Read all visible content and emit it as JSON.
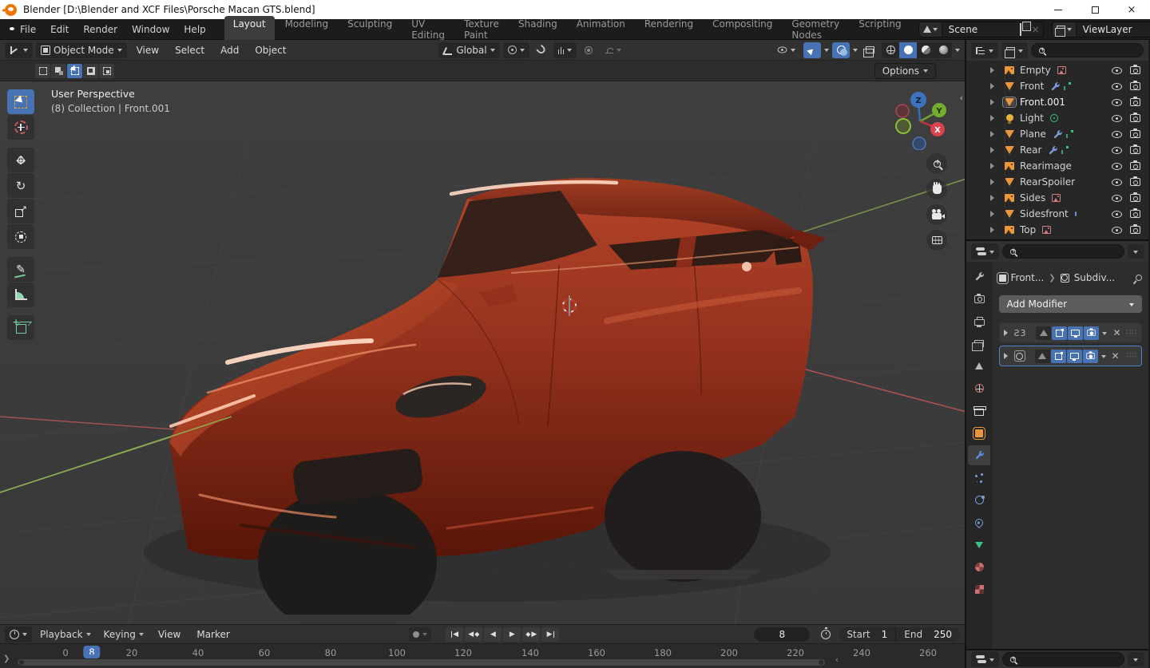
{
  "titlebar": {
    "title": "Blender [D:\\Blender and XCF Files\\Porsche Macan GTS.blend]"
  },
  "topbar": {
    "menus": [
      "File",
      "Edit",
      "Render",
      "Window",
      "Help"
    ],
    "tabs": [
      "Layout",
      "Modeling",
      "Sculpting",
      "UV Editing",
      "Texture Paint",
      "Shading",
      "Animation",
      "Rendering",
      "Compositing",
      "Geometry Nodes",
      "Scripting"
    ],
    "active_tab": "Layout",
    "scene": "Scene",
    "viewlayer": "ViewLayer"
  },
  "viewport": {
    "mode": "Object Mode",
    "menus": [
      "View",
      "Select",
      "Add",
      "Object"
    ],
    "orientation": "Global",
    "options_label": "Options",
    "overlay_line1": "User Perspective",
    "overlay_line2": "(8) Collection | Front.001",
    "gizmo": {
      "x": "X",
      "y": "Y",
      "z": "Z"
    }
  },
  "outliner": {
    "items": [
      {
        "name": "Empty",
        "type": "image",
        "extras": [
          "image-data"
        ]
      },
      {
        "name": "Front",
        "type": "mesh",
        "extras": [
          "wrench",
          "vertex-data"
        ]
      },
      {
        "name": "Front.001",
        "type": "mesh",
        "extras": [],
        "active": true
      },
      {
        "name": "Light",
        "type": "light",
        "extras": [
          "light-data"
        ]
      },
      {
        "name": "Plane",
        "type": "mesh",
        "extras": [
          "wrench",
          "vertex-data"
        ]
      },
      {
        "name": "Rear",
        "type": "mesh",
        "extras": [
          "wrench",
          "vertex-data"
        ]
      },
      {
        "name": "Rearimage",
        "type": "image",
        "extras": []
      },
      {
        "name": "RearSpoiler",
        "type": "mesh",
        "extras": []
      },
      {
        "name": "Sides",
        "type": "image",
        "extras": [
          "image-data"
        ]
      },
      {
        "name": "Sidesfront",
        "type": "mesh",
        "extras": [
          "misc-data"
        ]
      },
      {
        "name": "Top",
        "type": "image",
        "extras": [
          "image-data"
        ]
      }
    ]
  },
  "properties": {
    "breadcrumb_object": "Front...",
    "breadcrumb_modifier": "Subdiv...",
    "add_modifier_label": "Add Modifier",
    "modifiers": [
      {
        "type": "mirror",
        "selected": false
      },
      {
        "type": "subdivision-surface",
        "selected": true
      }
    ]
  },
  "timeline": {
    "menus": [
      "Playback",
      "Keying",
      "View",
      "Marker"
    ],
    "current_frame": "8",
    "start_label": "Start",
    "start_value": "1",
    "end_label": "End",
    "end_value": "250",
    "ruler": [
      "0",
      "20",
      "40",
      "60",
      "80",
      "100",
      "120",
      "140",
      "160",
      "180",
      "200",
      "220",
      "240",
      "260"
    ]
  },
  "colors": {
    "accent_blue": "#4772b3",
    "object_orange": "#e8973c",
    "data_pink": "#d37f7f",
    "data_green": "#3cc184",
    "car_body_red": "#a63823"
  }
}
